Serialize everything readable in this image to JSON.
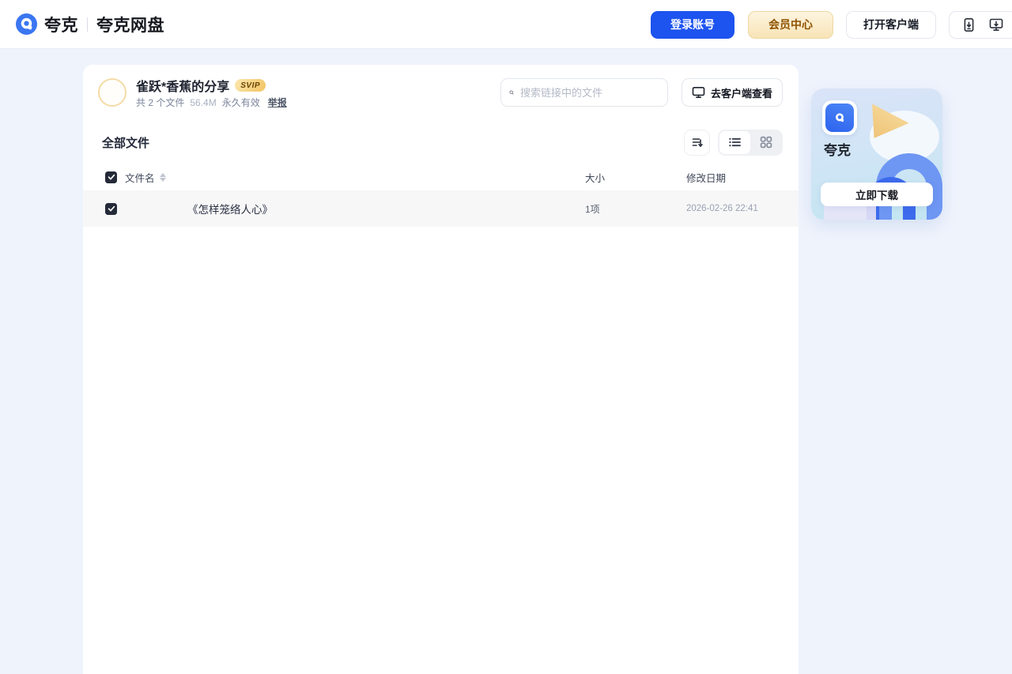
{
  "brand": {
    "name": "夸克",
    "product": "夸克网盘"
  },
  "header": {
    "login": "登录账号",
    "membership": "会员中心",
    "open_client": "打开客户端"
  },
  "share": {
    "title": "雀跃*香蕉的分享",
    "vip_badge": "SVIP",
    "file_count": "共 2 个文件",
    "total_size": "56.4M",
    "validity": "永久有效",
    "report": "举报",
    "search_placeholder": "搜索链接中的文件",
    "view_in_client": "去客户端查看"
  },
  "files": {
    "section_title": "全部文件",
    "columns": {
      "name": "文件名",
      "size": "大小",
      "modified": "修改日期"
    },
    "rows": [
      {
        "name": "《怎样笼络人心》",
        "size": "1项",
        "modified": "2026-02-26 22:41",
        "selected": true
      }
    ]
  },
  "promo": {
    "app_name": "夸克",
    "cta": "立即下载"
  },
  "colors": {
    "primary_blue": "#1D53EF",
    "brand_blue": "#3B76F2",
    "page_bg": "#EFF3FC",
    "vip_gold_text": "#8F5200",
    "row_selected_bg": "#F7F7F8",
    "promo_gradient_top": "#DAE4F8",
    "promo_gradient_bottom": "#C2E5F1"
  }
}
